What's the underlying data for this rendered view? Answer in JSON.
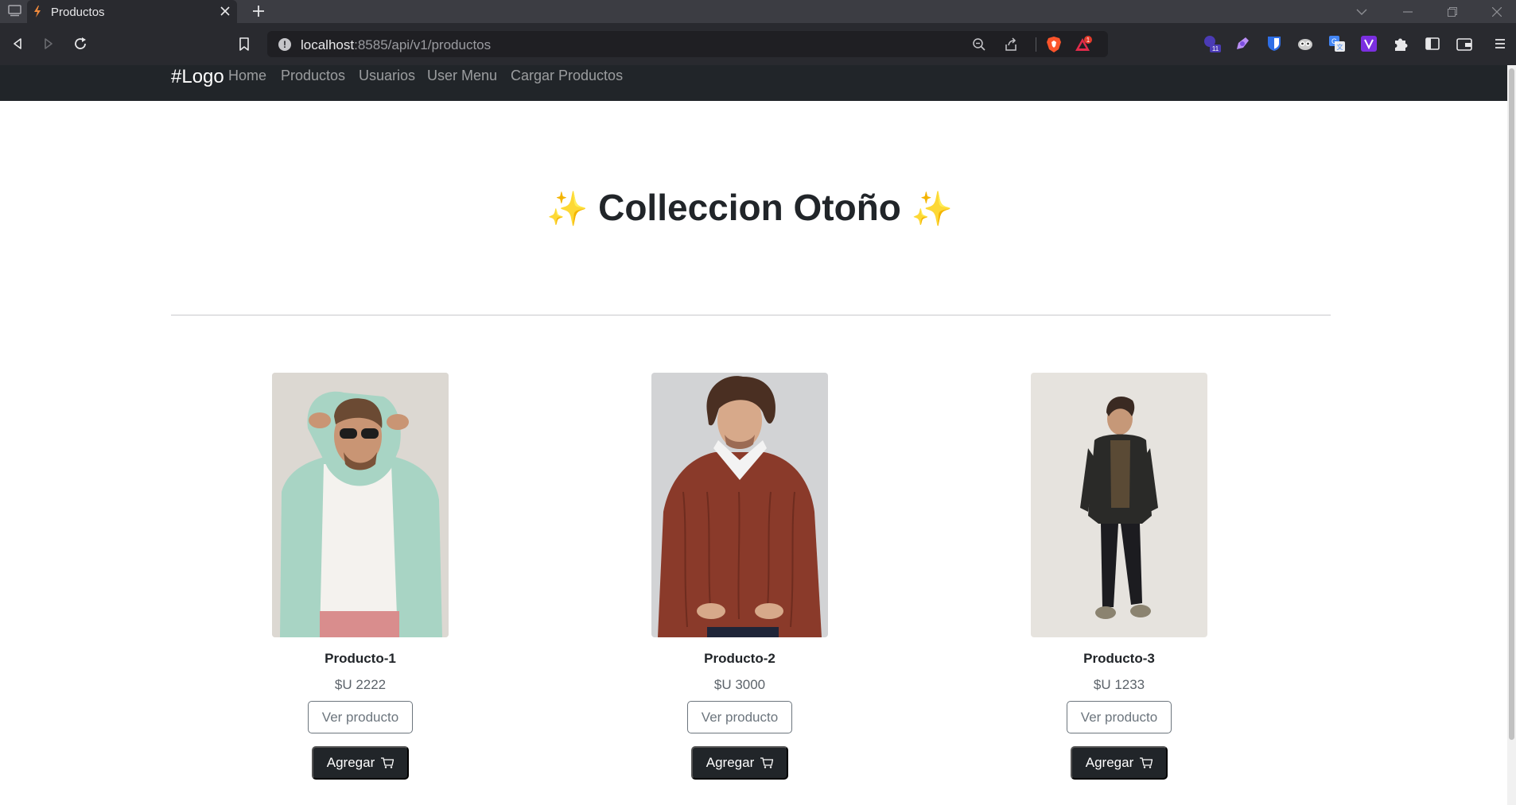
{
  "browser": {
    "tab_title": "Productos",
    "url_host": "localhost",
    "url_rest": ":8585/api/v1/productos",
    "notification_count": "1",
    "extension_badge": "11"
  },
  "navbar": {
    "brand": "#Logo",
    "links": [
      "Home",
      "Productos",
      "Usuarios",
      "User Menu",
      "Cargar Productos"
    ]
  },
  "hero": {
    "title": "Colleccion Otoño",
    "sparkle": "✨"
  },
  "products": [
    {
      "name": "Producto-1",
      "price": "$U 2222",
      "view_label": "Ver producto",
      "add_label": "Agregar"
    },
    {
      "name": "Producto-2",
      "price": "$U 3000",
      "view_label": "Ver producto",
      "add_label": "Agregar"
    },
    {
      "name": "Producto-3",
      "price": "$U 1233",
      "view_label": "Ver producto",
      "add_label": "Agregar"
    }
  ],
  "colors": {
    "navbar_bg": "#212529",
    "browser_chrome": "#292a2f",
    "button_dark": "#212529",
    "button_outline": "#6c757d"
  }
}
